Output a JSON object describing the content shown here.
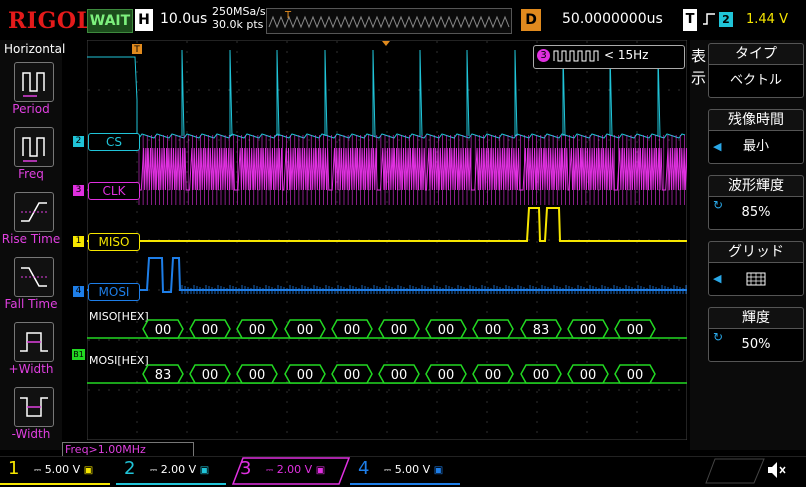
{
  "topbar": {
    "logo": "RIGOL",
    "run_status": "WAIT",
    "horizontal_label": "H",
    "timebase": "10.0us",
    "sample_rate": "250MSa/s",
    "memory_depth": "30.0k pts",
    "trigger_delay_label": "D",
    "trigger_delay": "50.0000000us",
    "trigger_label": "T",
    "trigger_source": "2",
    "trigger_level": "1.44 V"
  },
  "left_panel": {
    "title": "Horizontal",
    "items": [
      {
        "label": "Period",
        "icon": "period-icon"
      },
      {
        "label": "Freq",
        "icon": "freq-icon"
      },
      {
        "label": "Rise Time",
        "icon": "rise-time-icon"
      },
      {
        "label": "Fall Time",
        "icon": "fall-time-icon"
      },
      {
        "label": "+Width",
        "icon": "positive-width-icon"
      },
      {
        "label": "-Width",
        "icon": "negative-width-icon"
      }
    ],
    "freq_readout": "Freq>1.00MHz"
  },
  "screen": {
    "trigger_marker": "T",
    "counter_channel": "3",
    "counter_text": "< 15Hz",
    "channels": [
      {
        "num": "2",
        "name": "CS",
        "color": "#20c4d8"
      },
      {
        "num": "3",
        "name": "CLK",
        "color": "#e030e0"
      },
      {
        "num": "1",
        "name": "MISO",
        "color": "#f6e600"
      },
      {
        "num": "4",
        "name": "MOSI",
        "color": "#1e7ee8"
      }
    ],
    "bus_marker": "B1",
    "decode": {
      "miso_label": "MISO[HEX]",
      "mosi_label": "MOSI[HEX]",
      "miso": [
        "00",
        "00",
        "00",
        "00",
        "00",
        "00",
        "00",
        "00",
        "83",
        "00",
        "00"
      ],
      "mosi": [
        "83",
        "00",
        "00",
        "00",
        "00",
        "00",
        "00",
        "00",
        "00",
        "00",
        "00"
      ]
    }
  },
  "right_panel": {
    "title": "表示",
    "items": [
      {
        "head": "タイプ",
        "value": "ベクトル",
        "marker": ""
      },
      {
        "head": "残像時間",
        "value": "最小",
        "marker": "arrow"
      },
      {
        "head": "波形輝度",
        "value": "85%",
        "marker": "knob"
      },
      {
        "head": "グリッド",
        "value": "grid-icon",
        "marker": "arrow"
      },
      {
        "head": "輝度",
        "value": "50%",
        "marker": "knob"
      }
    ]
  },
  "bottom_bar": {
    "channels": [
      {
        "num": "1",
        "scale": "5.00 V",
        "color": "#f6e600"
      },
      {
        "num": "2",
        "scale": "2.00 V",
        "color": "#20c4d8"
      },
      {
        "num": "3",
        "scale": "2.00 V",
        "color": "#e030e0"
      },
      {
        "num": "4",
        "scale": "5.00 V",
        "color": "#1e7ee8"
      }
    ]
  },
  "colors": {
    "ch1": "#f6e600",
    "ch2": "#20c4d8",
    "ch3": "#e030e0",
    "ch4": "#1e7ee8",
    "decode": "#22d822",
    "trigger": "#e08a1e"
  }
}
